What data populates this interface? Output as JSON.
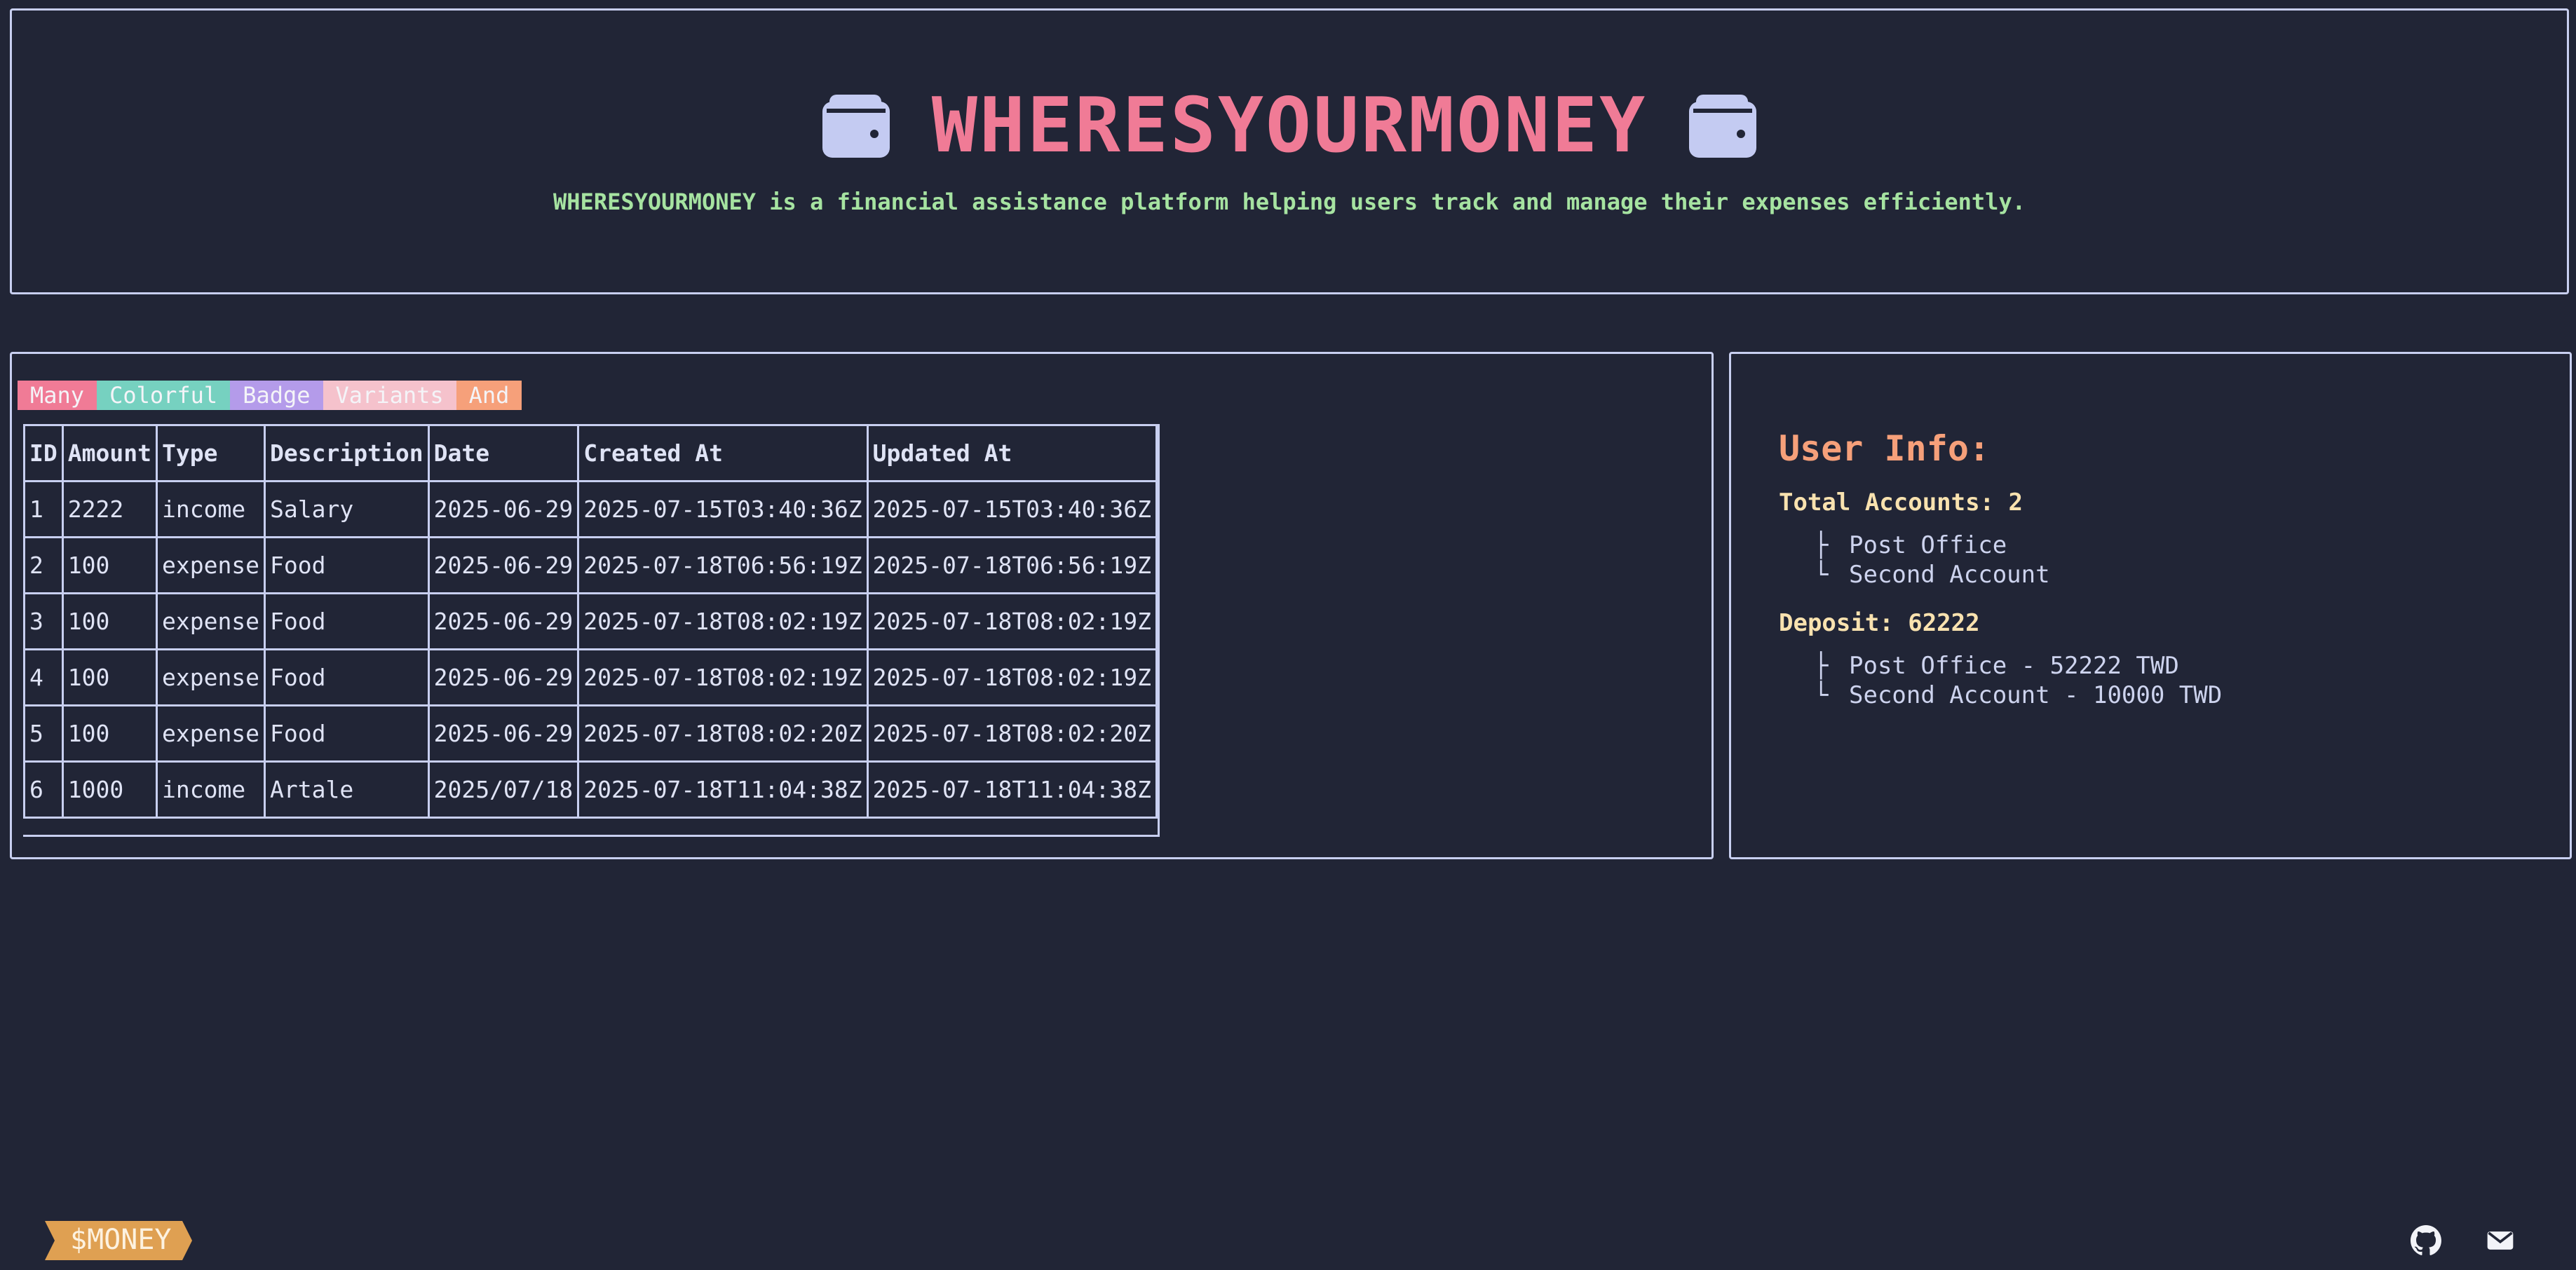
{
  "header": {
    "title": "WHERESYOURMONEY",
    "subtitle": "WHERESYOURMONEY is a financial assistance platform helping users track and manage their expenses efficiently.",
    "left_icon": "wallet-icon",
    "right_icon": "wallet-icon"
  },
  "badges": [
    "Many",
    "Colorful",
    "Badge",
    "Variants",
    "And"
  ],
  "table": {
    "columns": [
      "ID",
      "Amount",
      "Type",
      "Description",
      "Date",
      "Created At",
      "Updated At"
    ],
    "rows": [
      [
        "1",
        "2222",
        "income",
        "Salary",
        "2025-06-29",
        "2025-07-15T03:40:36Z",
        "2025-07-15T03:40:36Z"
      ],
      [
        "2",
        "100",
        "expense",
        "Food",
        "2025-06-29",
        "2025-07-18T06:56:19Z",
        "2025-07-18T06:56:19Z"
      ],
      [
        "3",
        "100",
        "expense",
        "Food",
        "2025-06-29",
        "2025-07-18T08:02:19Z",
        "2025-07-18T08:02:19Z"
      ],
      [
        "4",
        "100",
        "expense",
        "Food",
        "2025-06-29",
        "2025-07-18T08:02:19Z",
        "2025-07-18T08:02:19Z"
      ],
      [
        "5",
        "100",
        "expense",
        "Food",
        "2025-06-29",
        "2025-07-18T08:02:20Z",
        "2025-07-18T08:02:20Z"
      ],
      [
        "6",
        "1000",
        "income",
        "Artale",
        "2025/07/18",
        "2025-07-18T11:04:38Z",
        "2025-07-18T11:04:38Z"
      ]
    ]
  },
  "user_info": {
    "title": "User Info:",
    "total_accounts_label": "Total Accounts: 2",
    "accounts": [
      "Post Office",
      "Second Account"
    ],
    "deposit_label": "Deposit: 62222",
    "deposits": [
      "Post Office - 52222 TWD",
      "Second Account - 10000 TWD"
    ]
  },
  "footer": {
    "logo_text": "$MONEY",
    "icons": [
      "github-icon",
      "mail-icon"
    ]
  },
  "colors": {
    "background": "#212536",
    "title": "#f07b96",
    "subtitle": "#a6e3a1",
    "info_title": "#f6a07a",
    "info_label": "#f9e2af",
    "border": "#c8cff0",
    "logo": "#dfa052"
  }
}
